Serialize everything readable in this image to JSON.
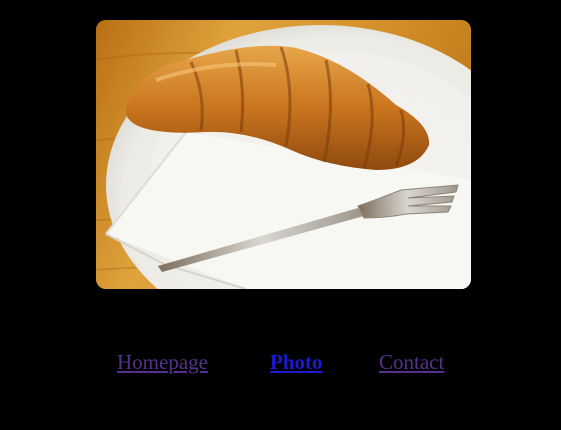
{
  "photo": {
    "alt": "Croissant on a white plate with a napkin and a fork",
    "icon": "croissant-photo"
  },
  "nav": {
    "items": [
      {
        "label": "Homepage",
        "state": "visited"
      },
      {
        "label": "Photo",
        "state": "current"
      },
      {
        "label": "Contact",
        "state": "visited"
      }
    ]
  },
  "colors": {
    "background": "#000000",
    "visited_link": "#55318b",
    "current_link": "#1a1ad6"
  }
}
